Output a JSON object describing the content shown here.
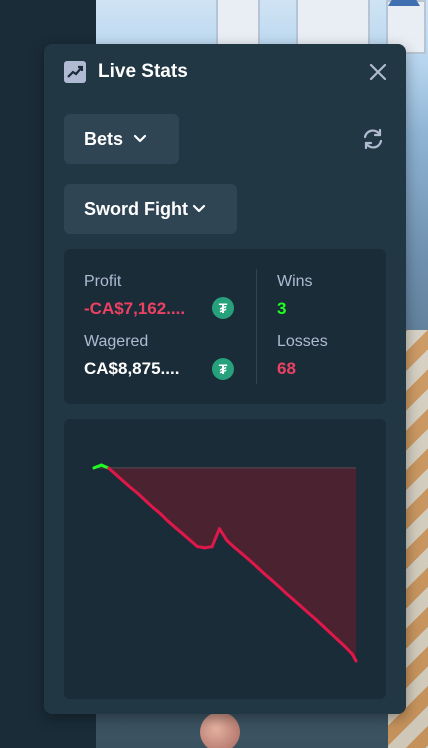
{
  "panel": {
    "title": "Live Stats",
    "title_icon": "trending-up-icon",
    "close_icon": "close-icon"
  },
  "filters": {
    "bets_label": "Bets",
    "game_label": "Sword Fight",
    "refresh_icon": "refresh-icon"
  },
  "stats": {
    "profit_label": "Profit",
    "profit_value": "-CA$7,162....",
    "wagered_label": "Wagered",
    "wagered_value": "CA$8,875....",
    "wins_label": "Wins",
    "wins_value": "3",
    "losses_label": "Losses",
    "losses_value": "68",
    "currency_icon": "tether-icon",
    "currency_symbol": "₮"
  },
  "colors": {
    "panel_bg": "#213743",
    "box_bg": "#1a2c38",
    "negative": "#ed4163",
    "positive": "#1fff20",
    "chart_loss_line": "#e0184a",
    "chart_win_line": "#1fff20",
    "chart_fill": "#4a2230"
  },
  "chart_data": {
    "type": "line",
    "x": [
      0,
      2,
      4,
      6,
      8,
      10,
      12,
      14,
      16,
      18,
      20,
      22,
      24,
      26,
      28,
      30,
      32,
      34,
      36,
      38,
      40,
      42,
      44,
      46,
      48,
      50,
      52,
      54,
      56,
      58,
      60,
      62,
      64,
      66,
      68,
      70,
      71
    ],
    "y": [
      0,
      1.9,
      -0.2,
      -4.5,
      -8.8,
      -13.0,
      -17.0,
      -21.5,
      -26.0,
      -30.0,
      -34.8,
      -39.0,
      -43.1,
      -47.3,
      -51.5,
      -52.4,
      -51.6,
      -39.8,
      -47.5,
      -52.0,
      -56.0,
      -60.2,
      -64.5,
      -69.0,
      -73.2,
      -77.5,
      -82.0,
      -86.2,
      -90.5,
      -94.8,
      -99.0,
      -103.5,
      -108.0,
      -112.5,
      -117.0,
      -122.0,
      -126.5
    ],
    "baseline": 0,
    "xlabel": "",
    "ylabel": "",
    "grid": false,
    "legend": "none"
  }
}
